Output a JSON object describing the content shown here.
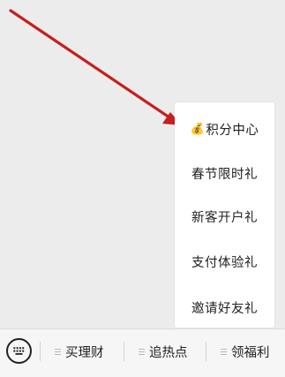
{
  "colors": {
    "background": "#ececec",
    "arrow": "#c81e1e",
    "menu_background": "#ffffff",
    "bar_background": "#f6f6f6",
    "text": "#222222"
  },
  "popup_menu": {
    "items": [
      {
        "label": "积分中心",
        "icon": "money-bag-icon",
        "icon_glyph": "💰"
      },
      {
        "label": "春节限时礼"
      },
      {
        "label": "新客开户礼"
      },
      {
        "label": "支付体验礼"
      },
      {
        "label": "邀请好友礼"
      }
    ]
  },
  "bottom_bar": {
    "keyboard_icon": "keyboard-icon",
    "tabs": [
      {
        "label": "买理财",
        "icon": "menu-icon"
      },
      {
        "label": "追热点",
        "icon": "menu-icon"
      },
      {
        "label": "领福利",
        "icon": "menu-icon"
      }
    ]
  }
}
